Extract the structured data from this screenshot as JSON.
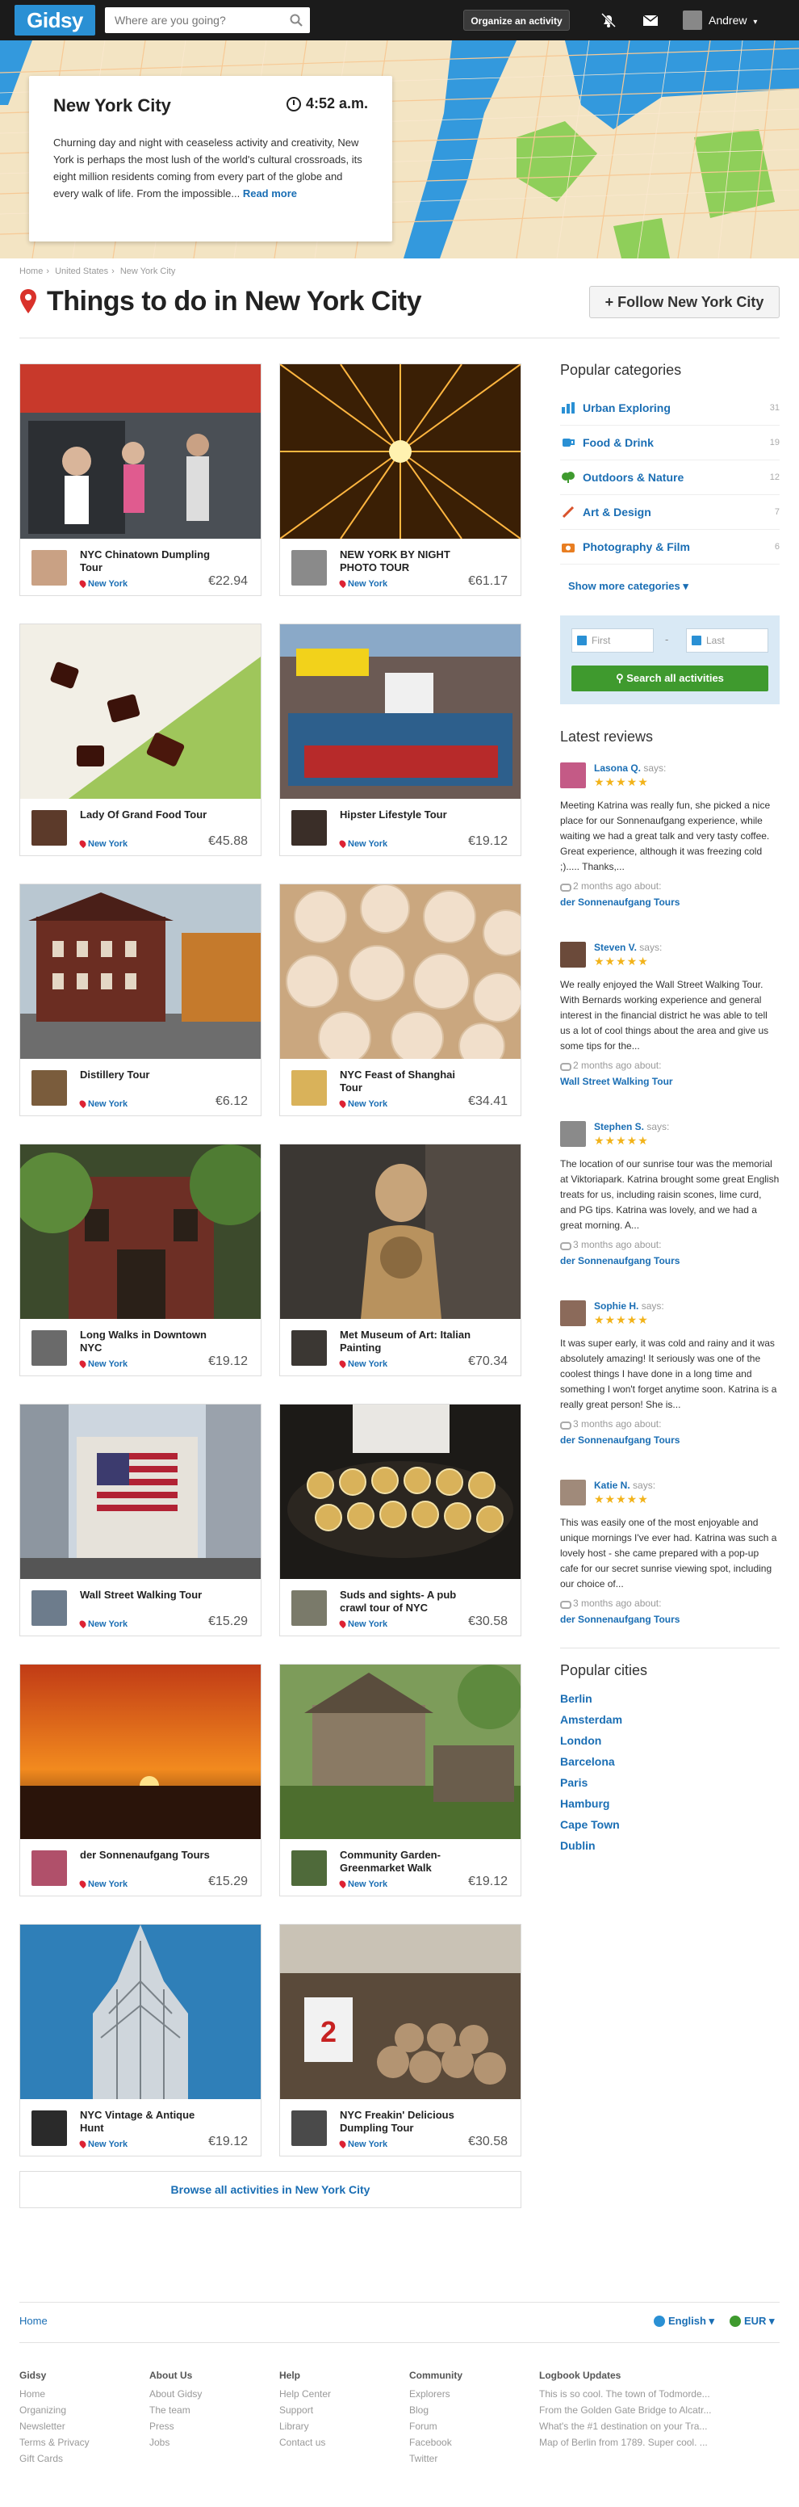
{
  "header": {
    "logo": "Gidsy",
    "search_placeholder": "Where are you going?",
    "organize_label": "Organize an activity",
    "user_name": "Andrew"
  },
  "hero": {
    "city": "New York City",
    "time": "4:52 a.m.",
    "description": "Churning day and night with ceaseless activity and creativity, New York is perhaps the most lush of the world's cultural crossroads, its eight million residents coming from every part of the globe and every walk of life. From the impossible...",
    "read_more": "Read more"
  },
  "breadcrumb": [
    "Home",
    "United States",
    "New York City"
  ],
  "page_title": "Things to do in New York City",
  "follow_label": "+ Follow New York City",
  "activities": [
    {
      "title": "NYC Chinatown Dumpling Tour",
      "location": "New York",
      "price": "€22.94"
    },
    {
      "title": "NEW YORK BY NIGHT PHOTO TOUR",
      "location": "New York",
      "price": "€61.17"
    },
    {
      "title": "Lady Of Grand Food Tour",
      "location": "New York",
      "price": "€45.88"
    },
    {
      "title": "Hipster Lifestyle Tour",
      "location": "New York",
      "price": "€19.12"
    },
    {
      "title": "Distillery Tour",
      "location": "New York",
      "price": "€6.12"
    },
    {
      "title": "NYC Feast of Shanghai Tour",
      "location": "New York",
      "price": "€34.41"
    },
    {
      "title": "Long Walks in Downtown NYC",
      "location": "New York",
      "price": "€19.12"
    },
    {
      "title": "Met Museum of Art: Italian Painting",
      "location": "New York",
      "price": "€70.34"
    },
    {
      "title": "Wall Street Walking Tour",
      "location": "New York",
      "price": "€15.29"
    },
    {
      "title": "Suds and sights- A pub crawl tour of NYC",
      "location": "New York",
      "price": "€30.58"
    },
    {
      "title": "der Sonnenaufgang Tours",
      "location": "New York",
      "price": "€15.29"
    },
    {
      "title": "Community Garden- Greenmarket Walk",
      "location": "New York",
      "price": "€19.12"
    },
    {
      "title": "NYC Vintage & Antique Hunt",
      "location": "New York",
      "price": "€19.12"
    },
    {
      "title": "NYC Freakin' Delicious Dumpling Tour",
      "location": "New York",
      "price": "€30.58"
    }
  ],
  "browse_all": "Browse all activities in New York City",
  "sidebar": {
    "categories_title": "Popular categories",
    "categories": [
      {
        "label": "Urban Exploring",
        "count": "31",
        "icon": "bar-chart-icon",
        "color": "#2a90d4"
      },
      {
        "label": "Food & Drink",
        "count": "19",
        "icon": "cup-icon",
        "color": "#2a90d4"
      },
      {
        "label": "Outdoors & Nature",
        "count": "12",
        "icon": "leaf-icon",
        "color": "#3f9a2e"
      },
      {
        "label": "Art & Design",
        "count": "7",
        "icon": "brush-icon",
        "color": "#d9532c"
      },
      {
        "label": "Photography & Film",
        "count": "6",
        "icon": "camera-icon",
        "color": "#e87e22"
      }
    ],
    "more_categories": "Show more categories ▾",
    "date_first": "First",
    "date_last": "Last",
    "date_sep": "-",
    "search_all": "Search all activities",
    "reviews_title": "Latest reviews",
    "reviews": [
      {
        "name": "Lasona Q.",
        "says": "says:",
        "stars": "★★★★★",
        "text": "Meeting Katrina was really fun, she picked a nice place for our Sonnenaufgang experience, while waiting we had a great talk and very tasty coffee. Great experience, although it was freezing cold ;)..... Thanks,...",
        "time": "2 months ago about:",
        "activity": "der Sonnenaufgang Tours"
      },
      {
        "name": "Steven V.",
        "says": "says:",
        "stars": "★★★★★",
        "text": "We really enjoyed the Wall Street Walking Tour. With Bernards working experience and general interest in the financial district he was able to tell us a lot of cool things about the area and give us some tips for the...",
        "time": "2 months ago about:",
        "activity": "Wall Street Walking Tour"
      },
      {
        "name": "Stephen S.",
        "says": "says:",
        "stars": "★★★★★",
        "text": "The location of our sunrise tour was the memorial at Viktoriapark. Katrina brought some great English treats for us, including raisin scones, lime curd, and PG tips. Katrina was lovely, and we had a great morning. A...",
        "time": "3 months ago about:",
        "activity": "der Sonnenaufgang Tours"
      },
      {
        "name": "Sophie H.",
        "says": "says:",
        "stars": "★★★★★",
        "text": "It was super early, it was cold and rainy and it was absolutely amazing! It seriously was one of the coolest things I have done in a long time and something I won't forget anytime soon. Katrina is a really great person! She is...",
        "time": "3 months ago about:",
        "activity": "der Sonnenaufgang Tours"
      },
      {
        "name": "Katie N.",
        "says": "says:",
        "stars": "★★★★★",
        "text": "This was easily one of the most enjoyable and unique mornings I've ever had. Katrina was such a lovely host - she came prepared with a pop-up cafe for our secret sunrise viewing spot, including our choice of...",
        "time": "3 months ago about:",
        "activity": "der Sonnenaufgang Tours"
      }
    ],
    "cities_title": "Popular cities",
    "cities": [
      "Berlin",
      "Amsterdam",
      "London",
      "Barcelona",
      "Paris",
      "Hamburg",
      "Cape Town",
      "Dublin"
    ]
  },
  "footer": {
    "home": "Home",
    "language": "English ▾",
    "currency": "EUR ▾",
    "columns": [
      {
        "heading": "Gidsy",
        "links": [
          "Home",
          "Organizing",
          "Newsletter",
          "Terms & Privacy",
          "Gift Cards"
        ]
      },
      {
        "heading": "About Us",
        "links": [
          "About Gidsy",
          "The team",
          "Press",
          "Jobs"
        ]
      },
      {
        "heading": "Help",
        "links": [
          "Help Center",
          "Support",
          "Library",
          "Contact us"
        ]
      },
      {
        "heading": "Community",
        "links": [
          "Explorers",
          "Blog",
          "Forum",
          "Facebook",
          "Twitter"
        ]
      },
      {
        "heading": "Logbook Updates",
        "links": [
          "This is so cool. The town of Todmorde...",
          "From the Golden Gate Bridge to Alcatr...",
          "What's the #1 destination on your Tra...",
          "Map of Berlin from 1789. Super cool. ..."
        ]
      }
    ]
  }
}
